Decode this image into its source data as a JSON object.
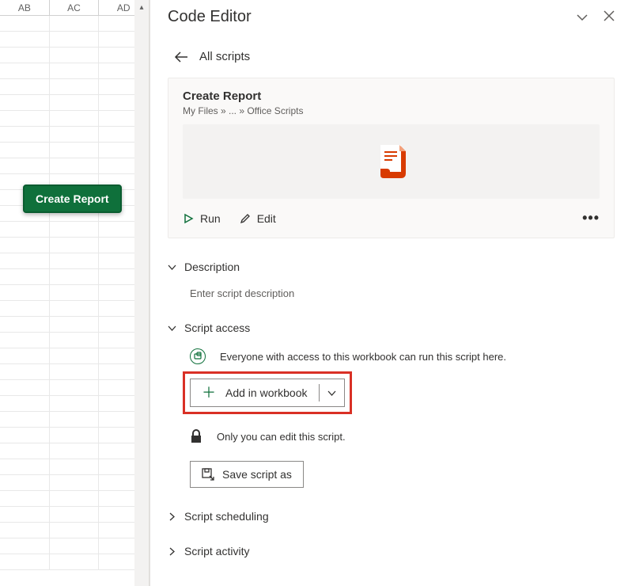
{
  "sheet": {
    "columns": [
      "AB",
      "AC",
      "AD"
    ]
  },
  "sheet_button": {
    "label": "Create Report"
  },
  "panel": {
    "title": "Code Editor",
    "back_label": "All scripts",
    "card": {
      "name": "Create Report",
      "breadcrumb": "My Files » ... » Office Scripts",
      "run_label": "Run",
      "edit_label": "Edit",
      "more_glyph": "•••"
    },
    "sections": {
      "description": {
        "title": "Description",
        "placeholder": "Enter script description"
      },
      "script_access": {
        "title": "Script access",
        "everyone_text": "Everyone with access to this workbook can run this script here.",
        "add_button": "Add in workbook",
        "only_you_text": "Only you can edit this script.",
        "save_as_label": "Save script as"
      },
      "scheduling": {
        "title": "Script scheduling"
      },
      "activity": {
        "title": "Script activity"
      }
    }
  },
  "icons": {
    "chevron_down": "⌄",
    "close": "✕",
    "back": "←",
    "expand": "⌄",
    "collapse_right": "›"
  }
}
